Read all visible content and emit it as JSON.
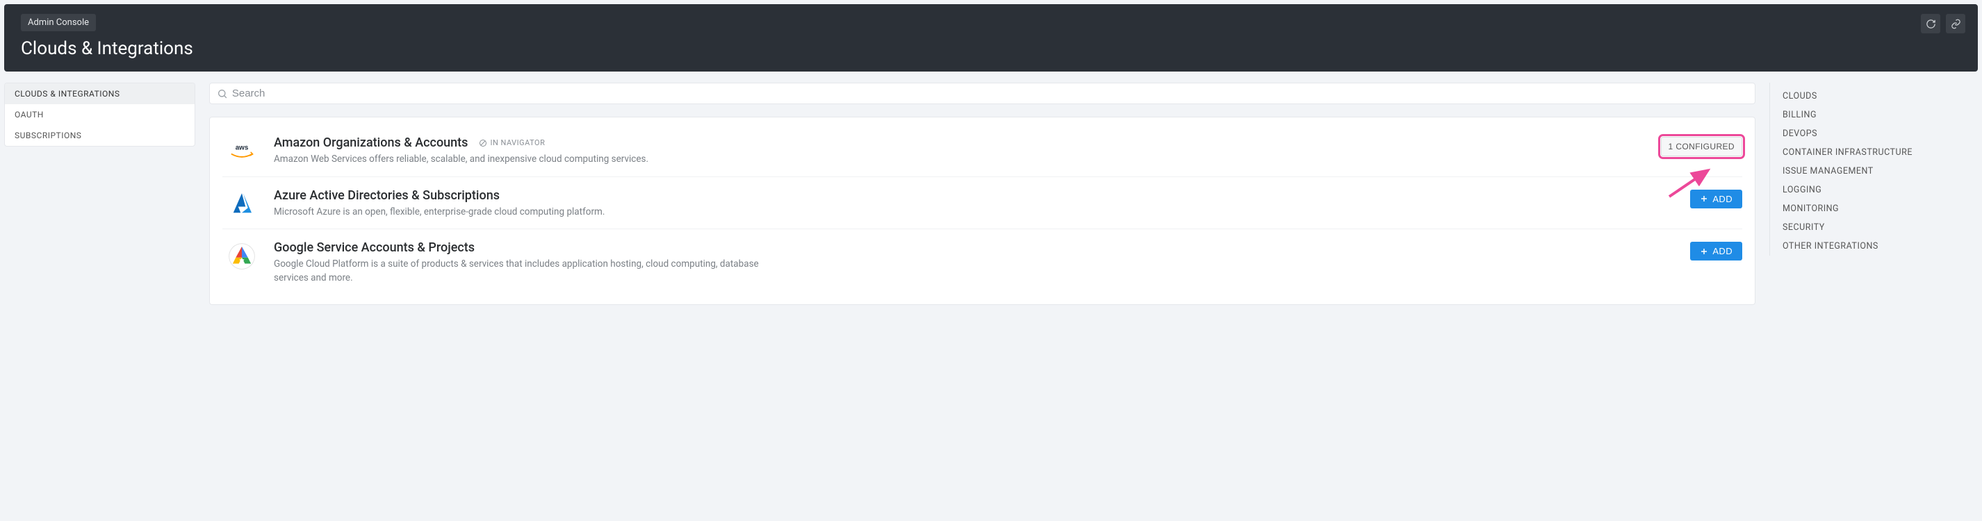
{
  "header": {
    "breadcrumb": "Admin Console",
    "title": "Clouds & Integrations"
  },
  "sidebar": {
    "items": [
      {
        "label": "CLOUDS & INTEGRATIONS",
        "active": true
      },
      {
        "label": "OAUTH",
        "active": false
      },
      {
        "label": "SUBSCRIPTIONS",
        "active": false
      }
    ]
  },
  "search": {
    "placeholder": "Search"
  },
  "integrations": [
    {
      "id": "aws",
      "title": "Amazon Organizations & Accounts",
      "status": "IN NAVIGATOR",
      "desc": "Amazon Web Services offers reliable, scalable, and inexpensive cloud computing services.",
      "action_type": "configured",
      "action_label": "1 CONFIGURED"
    },
    {
      "id": "azure",
      "title": "Azure Active Directories & Subscriptions",
      "status": null,
      "desc": "Microsoft Azure is an open, flexible, enterprise-grade cloud computing platform.",
      "action_type": "add",
      "action_label": "ADD"
    },
    {
      "id": "gcp",
      "title": "Google Service Accounts & Projects",
      "status": null,
      "desc": "Google Cloud Platform is a suite of products & services that includes application hosting, cloud computing, database services and more.",
      "action_type": "add",
      "action_label": "ADD"
    }
  ],
  "rightnav": {
    "items": [
      "CLOUDS",
      "BILLING",
      "DEVOPS",
      "CONTAINER INFRASTRUCTURE",
      "ISSUE MANAGEMENT",
      "LOGGING",
      "MONITORING",
      "SECURITY",
      "OTHER INTEGRATIONS"
    ]
  }
}
